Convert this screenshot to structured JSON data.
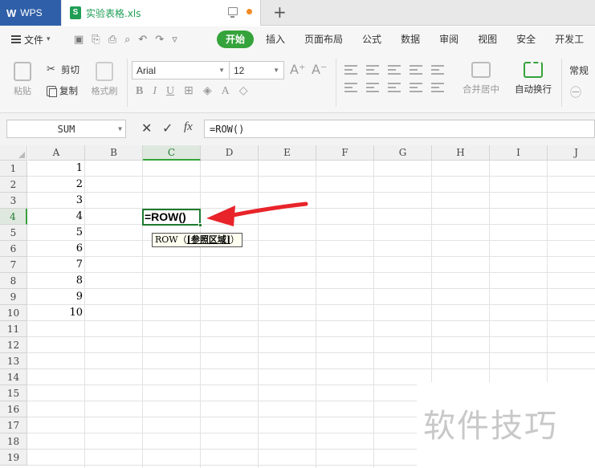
{
  "app": {
    "logo": "W",
    "name": "WPS"
  },
  "document": {
    "icon_letter": "S",
    "filename": "实验表格.xls"
  },
  "menu": {
    "file_label": "文件",
    "items": [
      "开始",
      "插入",
      "页面布局",
      "公式",
      "数据",
      "审阅",
      "视图",
      "安全",
      "开发工"
    ]
  },
  "ribbon": {
    "paste": "粘贴",
    "cut": "剪切",
    "copy": "复制",
    "format_painter": "格式刷",
    "font_name": "Arial",
    "font_size": "12",
    "merge_center": "合并居中",
    "wrap_text": "自动换行",
    "number_format": "常规"
  },
  "formula_bar": {
    "name_box": "SUM",
    "cancel": "✕",
    "confirm": "✓",
    "fx": "fx",
    "content": "=ROW()"
  },
  "sheet": {
    "columns": [
      "A",
      "B",
      "C",
      "D",
      "E",
      "F",
      "G",
      "H",
      "I",
      "J"
    ],
    "rows": [
      "1",
      "2",
      "3",
      "4",
      "5",
      "6",
      "7",
      "8",
      "9",
      "10",
      "11",
      "12",
      "13",
      "14",
      "15",
      "16",
      "17",
      "18",
      "19"
    ],
    "column_a_values": [
      "1",
      "2",
      "3",
      "4",
      "5",
      "6",
      "7",
      "8",
      "9",
      "10"
    ],
    "active_cell_text": "=ROW()",
    "tooltip_func": "ROW（",
    "tooltip_arg": "[参照区域]",
    "tooltip_close": "）"
  },
  "watermark": "软件技巧",
  "colors": {
    "accent": "#35a33b",
    "wps_blue": "#2f5fa8",
    "arrow_red": "#e8242a"
  }
}
